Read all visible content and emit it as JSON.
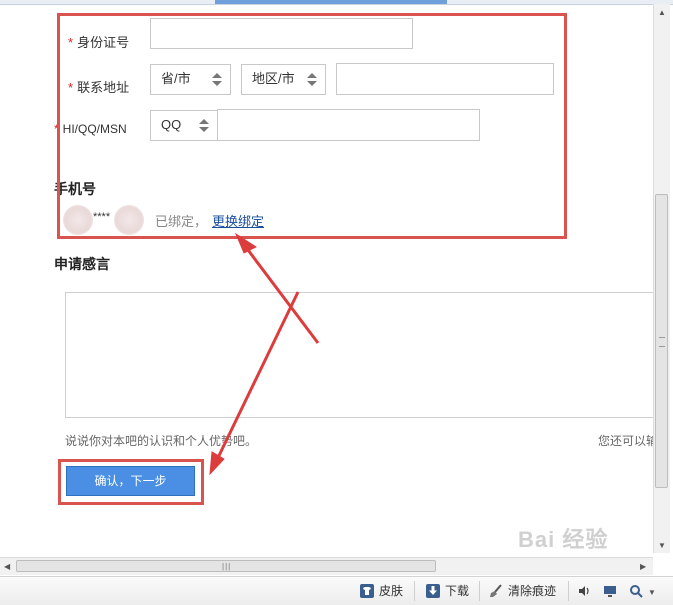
{
  "form": {
    "id_number": {
      "required_mark": "*",
      "label": "身份证号",
      "value": ""
    },
    "address": {
      "required_mark": "*",
      "label": "联系地址",
      "province_value": "省/市",
      "city_value": "地区/市",
      "detail_value": ""
    },
    "im": {
      "required_mark": "*",
      "label": "HI/QQ/MSN",
      "type_value": "QQ",
      "account_value": ""
    },
    "phone": {
      "label": "手机号",
      "masked": "****",
      "bound_status": "已绑定，",
      "rebind_link": "更换绑定"
    },
    "statement": {
      "label": "申请感言",
      "value": "",
      "hint_left": "说说你对本吧的认识和个人优势吧。",
      "hint_right": "您还可以输"
    },
    "submit_label": "确认，下一步"
  },
  "statusbar": {
    "skin_label": "皮肤",
    "download_label": "下载",
    "clear_label": "清除痕迹"
  },
  "colors": {
    "highlight_red": "#d9534f",
    "button_blue": "#4a8fe3"
  },
  "watermark": "Bai 经验"
}
